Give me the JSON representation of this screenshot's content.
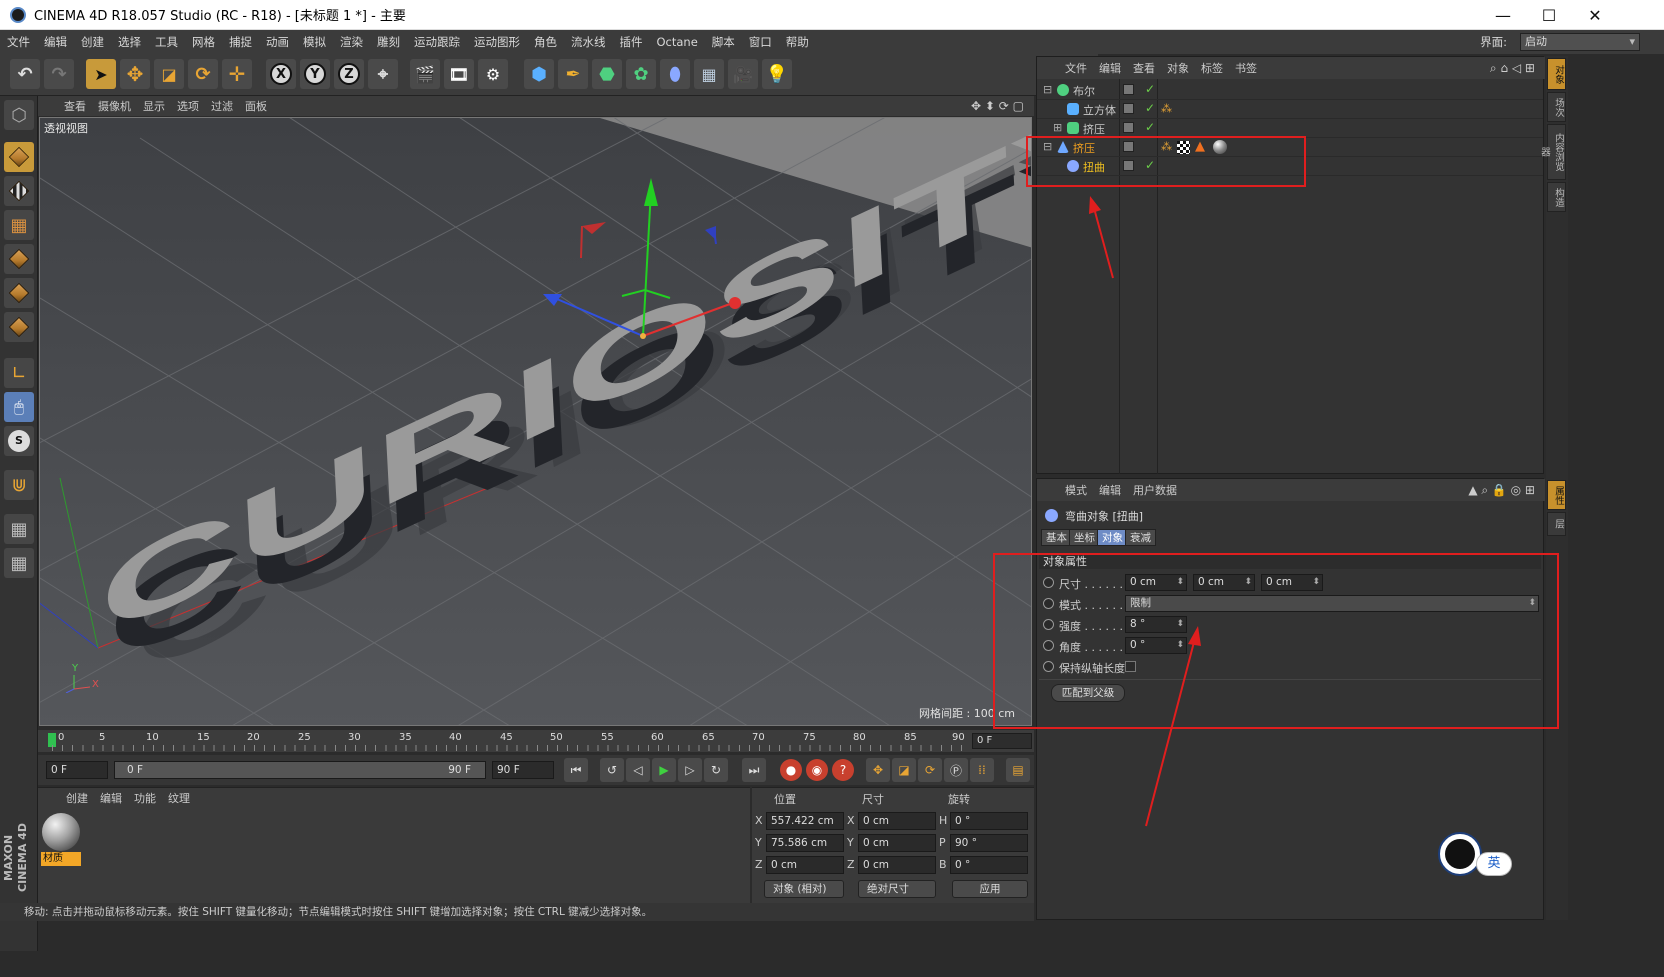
{
  "window": {
    "title": "CINEMA 4D R18.057 Studio (RC - R18) - [未标题 1 *] - 主要",
    "min": "—",
    "max": "☐",
    "close": "✕"
  },
  "menu": [
    "文件",
    "编辑",
    "创建",
    "选择",
    "工具",
    "网格",
    "捕捉",
    "动画",
    "模拟",
    "渲染",
    "雕刻",
    "运动跟踪",
    "运动图形",
    "角色",
    "流水线",
    "插件",
    "Octane",
    "脚本",
    "窗口",
    "帮助"
  ],
  "interface": {
    "label": "界面:",
    "value": "启动"
  },
  "toolbar": {
    "x": "X",
    "y": "Y",
    "z": "Z"
  },
  "viewport": {
    "menu": [
      "查看",
      "摄像机",
      "显示",
      "选项",
      "过滤",
      "面板"
    ],
    "label": "透视视图",
    "grid_spacing": "网格间距 : 100 cm",
    "scene_text": "CURIOSITY",
    "axis_y": "Y",
    "axis_x": "X"
  },
  "timeline": {
    "ticks": [
      "0",
      "5",
      "10",
      "15",
      "20",
      "25",
      "30",
      "35",
      "40",
      "45",
      "50",
      "55",
      "60",
      "65",
      "70",
      "75",
      "80",
      "85",
      "90"
    ],
    "current_frame": "0 F"
  },
  "playback": {
    "start": "0 F",
    "range_start": "0 F",
    "range_end": "90 F",
    "end": "90 F"
  },
  "materials": {
    "menu": [
      "创建",
      "编辑",
      "功能",
      "纹理"
    ],
    "items": [
      {
        "name": "材质"
      }
    ]
  },
  "coords": {
    "headers": {
      "position": "位置",
      "size": "尺寸",
      "rotation": "旋转"
    },
    "rows": [
      {
        "axis": "X",
        "pos": "557.422 cm",
        "size_axis": "X",
        "size": "0 cm",
        "rot_axis": "H",
        "rot": "0 °"
      },
      {
        "axis": "Y",
        "pos": "75.586 cm",
        "size_axis": "Y",
        "size": "0 cm",
        "rot_axis": "P",
        "rot": "90 °"
      },
      {
        "axis": "Z",
        "pos": "0 cm",
        "size_axis": "Z",
        "size": "0 cm",
        "rot_axis": "B",
        "rot": "0 °"
      }
    ],
    "mode": "对象 (相对)",
    "size_mode": "绝对尺寸",
    "apply": "应用"
  },
  "status": "移动: 点击并拖动鼠标移动元素。按住 SHIFT 键量化移动；节点编辑模式时按住 SHIFT 键增加选择对象；按住 CTRL 键减少选择对象。",
  "side_logo": "MAXON CINEMA 4D",
  "object_manager": {
    "menu": [
      "文件",
      "编辑",
      "查看",
      "对象",
      "标签",
      "书签"
    ],
    "objects": [
      {
        "name": "布尔",
        "color": "#c8c8c8"
      },
      {
        "name": "立方体",
        "color": "#c8c8c8"
      },
      {
        "name": "挤压",
        "color": "#c8c8c8"
      },
      {
        "name": "挤压",
        "color": "#f0a020"
      },
      {
        "name": "扭曲",
        "color": "#f0c020"
      }
    ]
  },
  "attribute_manager": {
    "menu": [
      "模式",
      "编辑",
      "用户数据"
    ],
    "object_title": "弯曲对象 [扭曲]",
    "tabs": [
      "基本",
      "坐标",
      "对象",
      "衰减"
    ],
    "section": "对象属性",
    "fields": {
      "size_label": "尺寸 . . . . . . .",
      "size": [
        "0 cm",
        "0 cm",
        "0 cm"
      ],
      "mode_label": "模式 . . . . . . .",
      "mode": "限制",
      "strength_label": "强度 . . . . . . .",
      "strength": "8 °",
      "angle_label": "角度 . . . . . . .",
      "angle": "0 °",
      "keep_label": "保持纵轴长度"
    },
    "match_parent": "匹配到父级"
  },
  "right_tabs": [
    "对象",
    "场次",
    "内容浏览器",
    "构造",
    "属性",
    "层"
  ],
  "badge": {
    "text": "英"
  },
  "colors": {
    "accent": "#c8912c",
    "annotation": "#e01e1e"
  }
}
